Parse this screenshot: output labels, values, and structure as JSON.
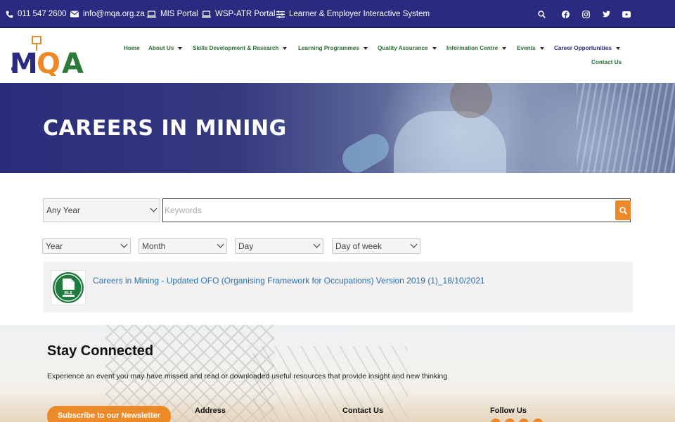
{
  "topbar": {
    "phone": "011 547 2600",
    "email": "info@mqa.org.za",
    "mis_portal": "MIS Portal",
    "wsp_portal": "WSP-ATR Portal",
    "learner_system": "Learner & Employer Interactive System",
    "icons": [
      "search-icon",
      "facebook-icon",
      "instagram-icon",
      "twitter-icon",
      "youtube-icon"
    ]
  },
  "nav": {
    "items": [
      {
        "label": "Home"
      },
      {
        "label": "About Us"
      },
      {
        "label": "Skills Development & Research"
      },
      {
        "label": "Learning Programmes"
      },
      {
        "label": "Quality Assurance"
      },
      {
        "label": "Information Centre"
      },
      {
        "label": "Events"
      },
      {
        "label": "Career Opportunities"
      },
      {
        "label": "Contact Us"
      }
    ]
  },
  "hero": {
    "title": "CAREERS IN MINING"
  },
  "filters": {
    "year_select": "Any Year",
    "keywords_placeholder": "Keywords",
    "year": "Year",
    "month": "Month",
    "day": "Day",
    "day_of_week": "Day of week"
  },
  "results": [
    {
      "title": "Careers in Mining - Updated OFO (Organising Framework for Occupations) Version 2019 (1)_18/10/2021",
      "file_type": "XLS"
    }
  ],
  "footer": {
    "stay_title": "Stay Connected",
    "stay_text": "Experience an event you may have missed and read or downloaded useful resources that provide insight and new thinking",
    "subscribe": "Subscribe to our Newsletter",
    "address": "Address",
    "contact": "Contact Us",
    "follow": "Follow Us"
  },
  "colors": {
    "topbar": "#2a2a80",
    "nav_text": "#2b6e35",
    "accent_orange": "#ec8a2a",
    "link": "#2a6fb2",
    "excel_green": "#1e7a3c"
  }
}
